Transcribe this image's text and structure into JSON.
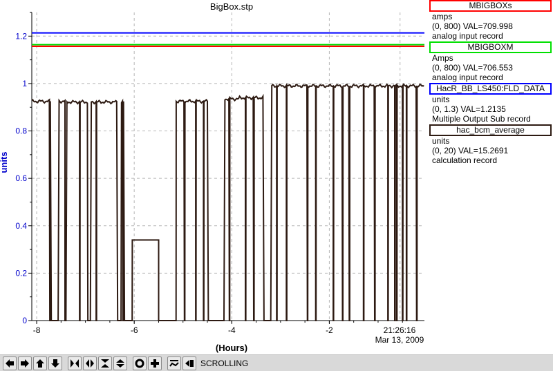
{
  "chart_data": {
    "type": "line",
    "title": "BigBox.stp",
    "xlabel": "(Hours)",
    "ylabel": "units",
    "xlim": [
      -8.1,
      -0.05
    ],
    "ylim": [
      0,
      1.3
    ],
    "x_ticks": [
      -8,
      -6,
      -4,
      -2
    ],
    "y_ticks": [
      0,
      0.2,
      0.4,
      0.6,
      0.8,
      1,
      1.2
    ],
    "y_tick_labels": [
      "0",
      "0.2",
      "0.4",
      "0.6",
      "0.8",
      "1",
      "1.2"
    ],
    "x_tick_labels": [
      "-8",
      "-6",
      "-4",
      "-2"
    ],
    "end_time": "21:26:16",
    "end_date": "Mar 13, 2009",
    "grid": true,
    "series": [
      {
        "name": "MBIGBOXs",
        "color": "#ff0000",
        "constant": 1.157
      },
      {
        "name": "MBIGBOXM",
        "color": "#00dd00",
        "constant": 1.164
      },
      {
        "name": "HacR_BB_LS450:FLD_DATA",
        "color": "#0000ff",
        "constant": 1.2135
      },
      {
        "name": "hac_bcm_average",
        "color": "#2d1a12",
        "segments": [
          {
            "x0": -8.1,
            "x1": -7.72,
            "level": 0.925
          },
          {
            "x0": -7.55,
            "x1": -7.42,
            "level": 0.925
          },
          {
            "x0": -7.4,
            "x1": -6.95,
            "level": 0.922
          },
          {
            "x0": -6.9,
            "x1": -6.35,
            "level": 0.922
          },
          {
            "x0": -6.27,
            "x1": -6.22,
            "level": 0.92
          },
          {
            "x0": -6.05,
            "x1": -5.5,
            "level": 0.34
          },
          {
            "x0": -5.15,
            "x1": -4.5,
            "level": 0.925
          },
          {
            "x0": -4.15,
            "x1": -3.85,
            "level": 0.935
          },
          {
            "x0": -3.85,
            "x1": -3.35,
            "level": 0.94
          },
          {
            "x0": -3.2,
            "x1": -0.05,
            "level": 0.99
          }
        ],
        "dropouts": [
          -7.73,
          -7.6,
          -7.42,
          -7.12,
          -6.95,
          -6.78,
          -6.28,
          -6.23,
          -6.2,
          -6.05,
          -5.5,
          -5.3,
          -5.22,
          -5.15,
          -4.97,
          -4.74,
          -4.58,
          -4.45,
          -4.05,
          -3.72,
          -3.55,
          -3.33,
          -3.28,
          -3.08,
          -2.88,
          -2.45,
          -2.28,
          -1.92,
          -1.73,
          -1.59,
          -1.3,
          -1.07,
          -0.8,
          -0.66,
          -0.62,
          -0.5,
          -0.42,
          -0.21
        ]
      }
    ]
  },
  "legend": [
    {
      "name": "MBIGBOXs",
      "units": "amps",
      "range_val": "(0, 800)  VAL=709.998",
      "record": "analog input record",
      "border": "#ff0000"
    },
    {
      "name": "MBIGBOXM",
      "units": "Amps",
      "range_val": "(0, 800)  VAL=706.553",
      "record": "analog input record",
      "border": "#00e000"
    },
    {
      "name": "HacR_BB_LS450:FLD_DATA",
      "units": "units",
      "range_val": "(0, 1.3)  VAL=1.2135",
      "record": "Multiple Output Sub record",
      "border": "#0000ff"
    },
    {
      "name": "hac_bcm_average",
      "units": "units",
      "range_val": "(0, 20)  VAL=15.2691",
      "record": "calculation record",
      "border": "#2d1a12"
    }
  ],
  "toolbar": {
    "buttons": [
      "arrow-left-icon",
      "arrow-right-icon",
      "arrow-up-icon",
      "arrow-down-icon",
      "zoom-in-horizontal-icon",
      "zoom-out-horizontal-icon",
      "zoom-in-vertical-icon",
      "zoom-out-vertical-icon",
      "reset-icon",
      "crosshair-icon",
      "pan-icon",
      "back-icon"
    ],
    "status": "SCROLLING"
  }
}
